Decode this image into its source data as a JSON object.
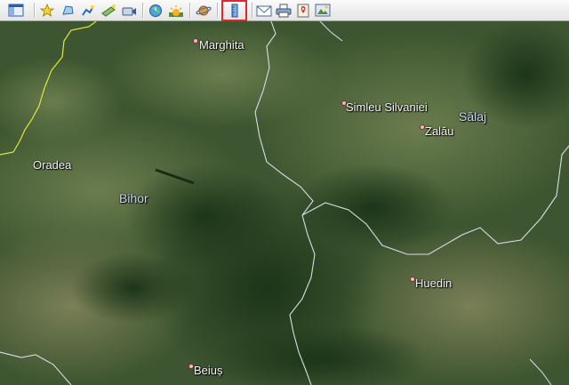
{
  "toolbar": {
    "buttons": [
      {
        "name": "sidebar-toggle-button",
        "icon": "sidebar-icon"
      },
      {
        "name": "add-placemark-button",
        "icon": "placemark-star-icon"
      },
      {
        "name": "add-polygon-button",
        "icon": "polygon-icon"
      },
      {
        "name": "add-path-button",
        "icon": "path-icon"
      },
      {
        "name": "add-image-overlay-button",
        "icon": "image-overlay-icon"
      },
      {
        "name": "record-tour-button",
        "icon": "record-tour-icon"
      },
      {
        "name": "historical-imagery-button",
        "icon": "clock-globe-icon"
      },
      {
        "name": "sunlight-button",
        "icon": "sun-icon"
      },
      {
        "name": "switch-to-sky-button",
        "icon": "planet-icon"
      },
      {
        "name": "ruler-button",
        "icon": "ruler-icon",
        "highlighted": true
      },
      {
        "name": "email-button",
        "icon": "envelope-icon"
      },
      {
        "name": "print-button",
        "icon": "printer-icon"
      },
      {
        "name": "view-in-maps-button",
        "icon": "maps-icon"
      },
      {
        "name": "save-image-button",
        "icon": "save-image-icon"
      }
    ]
  },
  "map": {
    "places": [
      {
        "label": "Marghita"
      },
      {
        "label": "Simleu Silvaniei"
      },
      {
        "label": "Zalău"
      },
      {
        "label": "Oradea"
      },
      {
        "label": "Huedin"
      },
      {
        "label": "Beiuș"
      }
    ],
    "regions": [
      {
        "label": "Sălaj"
      },
      {
        "label": "Bihor"
      }
    ],
    "borders": {
      "country_color": "#e0e83a",
      "county_color": "#d8dde6"
    }
  }
}
